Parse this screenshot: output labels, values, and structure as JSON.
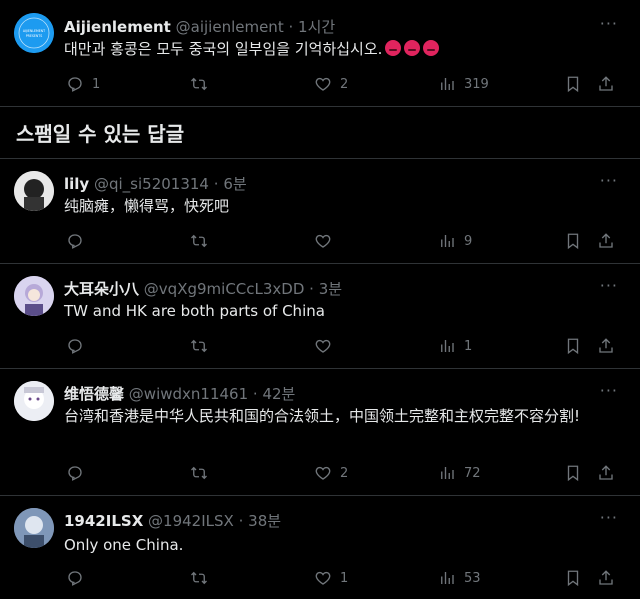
{
  "main_post": {
    "name": "Aijienlement",
    "handle": "@aijienlement",
    "sep": "·",
    "time": "1시간",
    "text": "대만과 홍콩은 모두 중국의 일부임을 기억하십시오.",
    "emojis": [
      "angry-face",
      "angry-face",
      "angry-face"
    ],
    "replies": "1",
    "reposts": "",
    "likes": "2",
    "views": "319",
    "avatar_text": "AIJIENLEMENT PRESENTS"
  },
  "section": {
    "title": "스팸일 수 있는 답글"
  },
  "replies": [
    {
      "name": "lily",
      "handle": "@qi_si5201314",
      "sep": "·",
      "time": "6분",
      "text": "纯脑瘫，懒得骂，快死吧",
      "replies": "",
      "reposts": "",
      "likes": "",
      "views": "9"
    },
    {
      "name": "大耳朵小八",
      "handle": "@vqXg9miCCcL3xDD",
      "sep": "·",
      "time": "3분",
      "text": "TW and HK are both parts of China",
      "replies": "",
      "reposts": "",
      "likes": "",
      "views": "1"
    },
    {
      "name": "维悟德馨",
      "handle": "@wiwdxn11461",
      "sep": "·",
      "time": "42분",
      "text": "台湾和香港是中华人民共和国的合法领土，中国领土完整和主权完整不容分割!",
      "replies": "",
      "reposts": "",
      "likes": "2",
      "views": "72"
    },
    {
      "name": "1942ILSX",
      "handle": "@1942ILSX",
      "sep": "·",
      "time": "38분",
      "text": "Only one China.",
      "replies": "",
      "reposts": "",
      "likes": "1",
      "views": "53"
    }
  ],
  "colors": {
    "background": "#000000",
    "text": "#e7e9ea",
    "muted": "#71767b",
    "divider": "#2f3336",
    "avatar_main": "#1d9bf0"
  },
  "icons": [
    "reply-icon",
    "repost-icon",
    "like-icon",
    "views-icon",
    "bookmark-icon",
    "share-icon",
    "more-icon"
  ]
}
